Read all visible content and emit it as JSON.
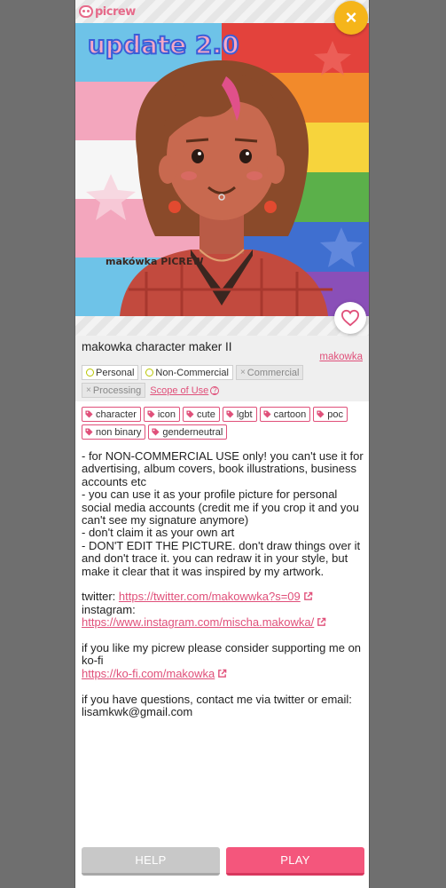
{
  "app": {
    "logo_text": "picrew",
    "close_label": "×"
  },
  "artwork": {
    "overlay_title": "update 2.0",
    "signature": "makówka PICREW"
  },
  "maker": {
    "title": "makowka character maker II",
    "author": "makowka"
  },
  "scope": {
    "items": [
      {
        "label": "Personal",
        "allowed": true
      },
      {
        "label": "Non-Commercial",
        "allowed": true
      },
      {
        "label": "Commercial",
        "allowed": false
      },
      {
        "label": "Processing",
        "allowed": false
      }
    ],
    "link_label": "Scope of Use",
    "help_icon": "?"
  },
  "tags": [
    "character",
    "icon",
    "cute",
    "lgbt",
    "cartoon",
    "poc",
    "non binary",
    "genderneutral"
  ],
  "description": {
    "lines": [
      "- for NON-COMMERCIAL USE only! you can't use it for advertising, album covers, book illustrations, business accounts etc",
      "- you can use it as your profile picture for personal social media accounts (credit me if you crop it and you can't see my signature anymore)",
      "- don't claim it as your own art",
      "- DON'T EDIT THE PICTURE. don't draw things over it and don't trace it. you can redraw it in your style, but make it clear that it was inspired by my artwork."
    ],
    "twitter_label": "twitter:",
    "twitter_url": "https://twitter.com/makowwka?s=09",
    "instagram_label": "instagram:",
    "instagram_url": "https://www.instagram.com/mischa.makowka/",
    "kofi_text": "if you like my picrew please consider supporting me on ko-fi",
    "kofi_url": "https://ko-fi.com/makowka",
    "contact_text": "if you have questions, contact me via twitter or email:",
    "email": "lisamkwk@gmail.com"
  },
  "buttons": {
    "help": "HELP",
    "play": "PLAY"
  },
  "colors": {
    "accent": "#f4567c",
    "link": "#e0507a",
    "close": "#f5b51a"
  }
}
